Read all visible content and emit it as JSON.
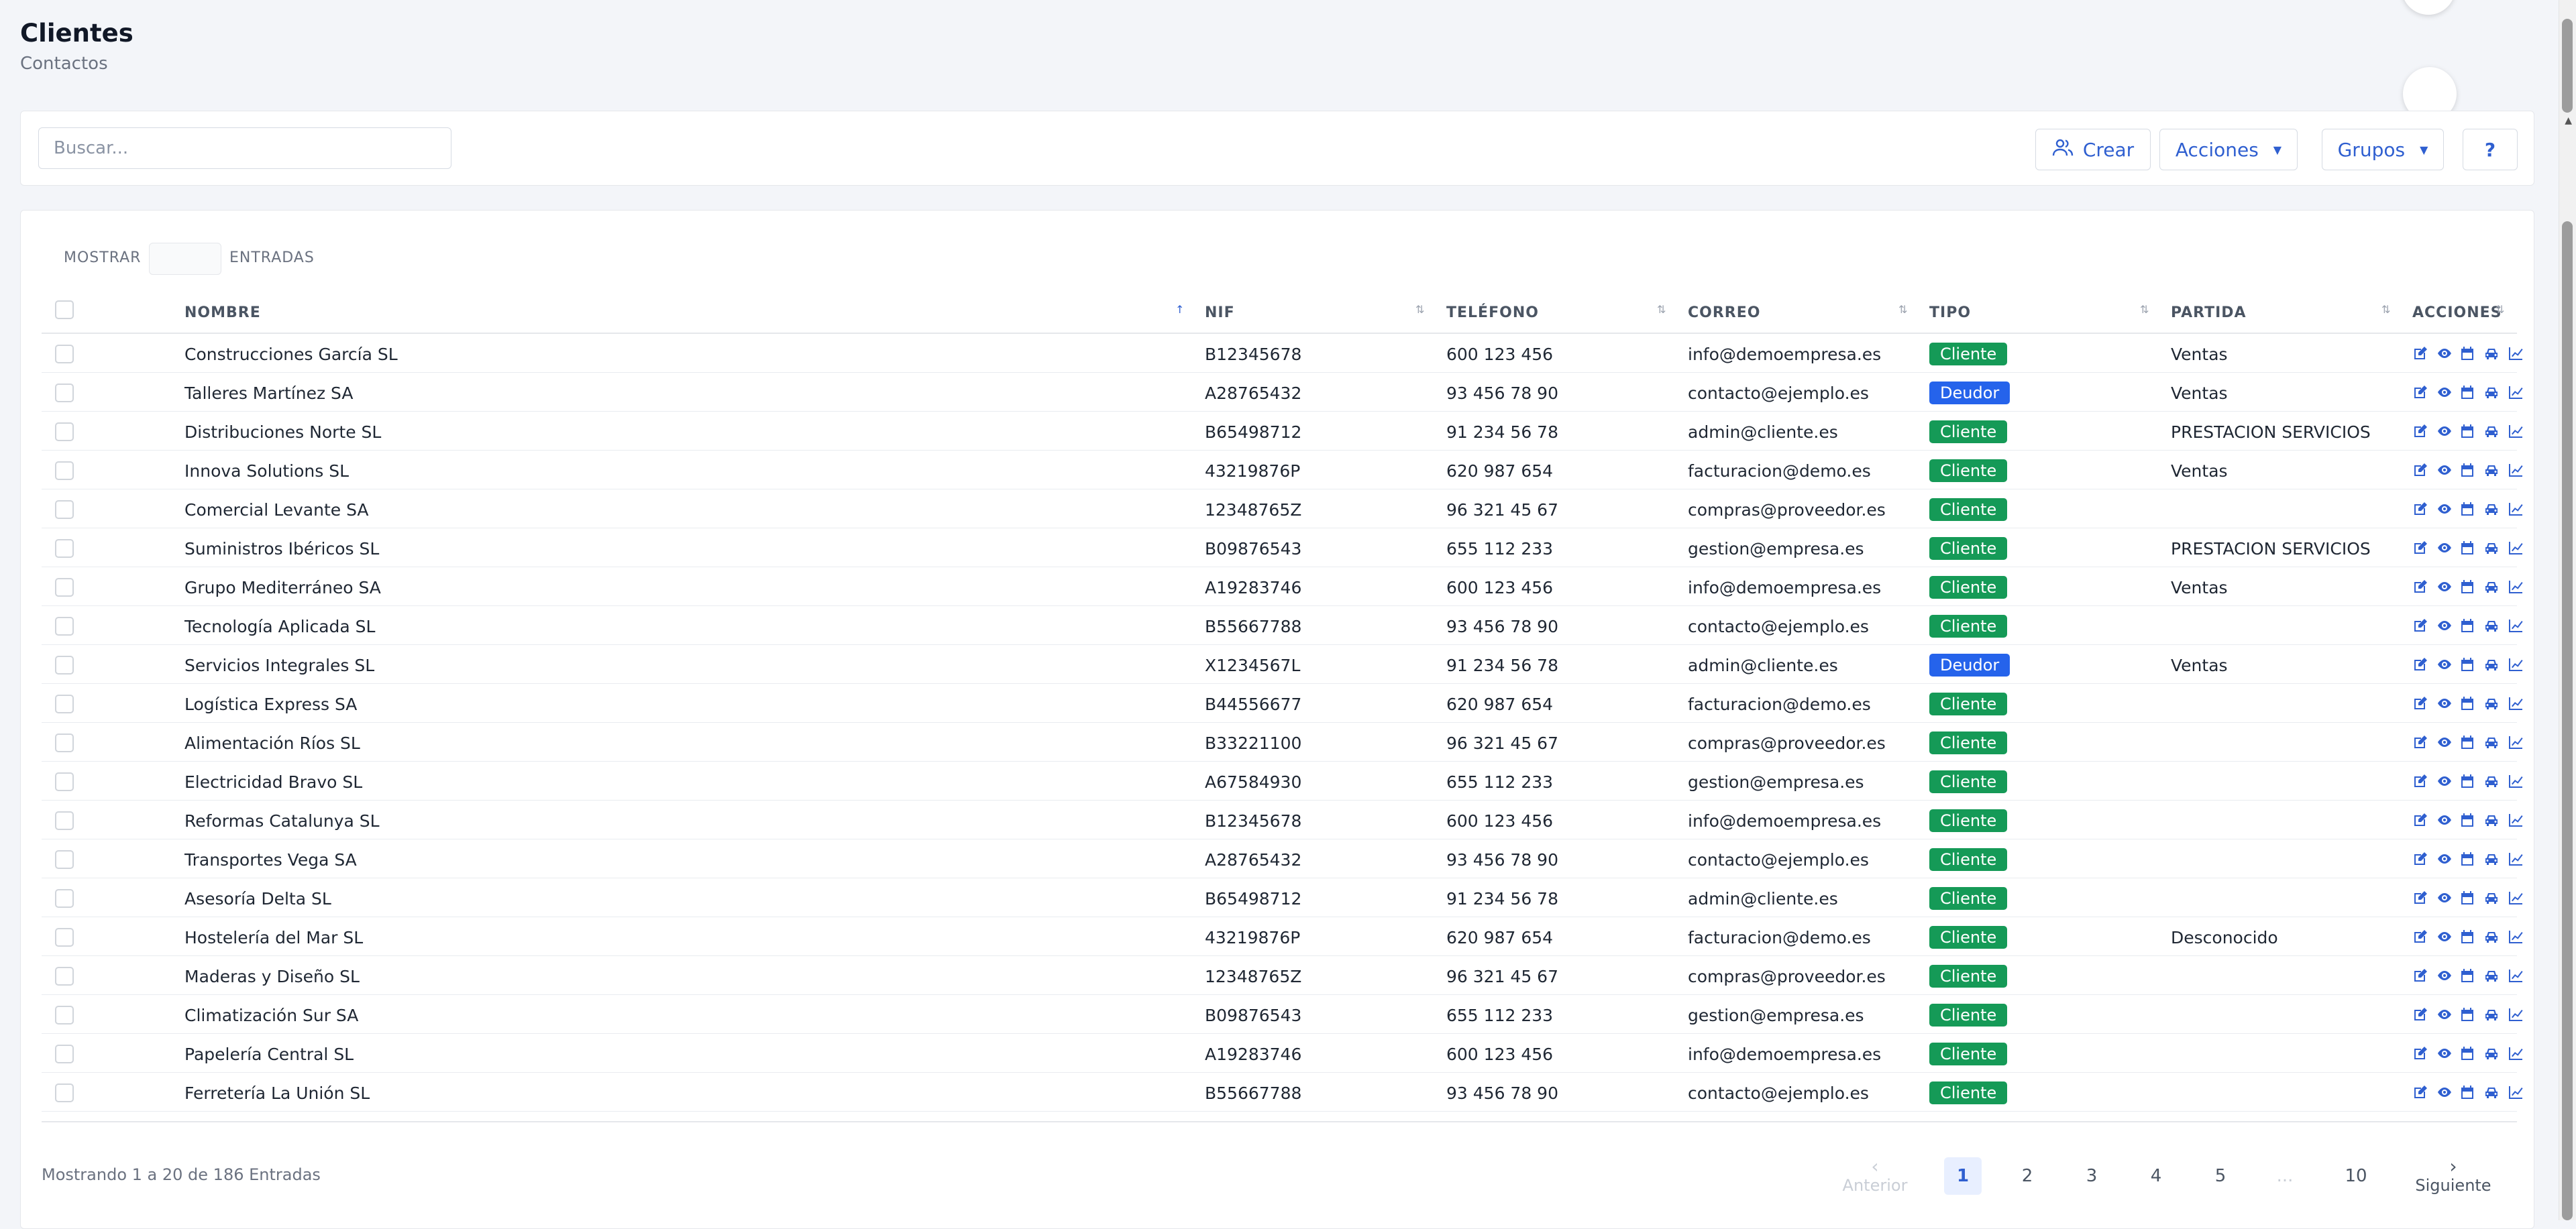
{
  "header": {
    "title": "Clientes",
    "subtitle": "Contactos"
  },
  "toolbar": {
    "search_placeholder": "Buscar...",
    "create_label": "Crear",
    "actions_label": "Acciones",
    "groups_label": "Grupos",
    "help_label": "?"
  },
  "length_menu": {
    "show_label": "MOSTRAR",
    "entries_label": "ENTRADAS"
  },
  "table": {
    "columns": [
      "NOMBRE",
      "NIF",
      "TELÉFONO",
      "CORREO",
      "TIPO",
      "PARTIDA",
      "ACCIONES"
    ],
    "rows": [
      {
        "nombre": "Construcciones García SL",
        "nif": "B12345678",
        "telefono": "600 123 456",
        "correo": "info@demoempresa.es",
        "tipo": "Cliente",
        "partida": "Ventas"
      },
      {
        "nombre": "Talleres Martínez SA",
        "nif": "A28765432",
        "telefono": "93 456 78 90",
        "correo": "contacto@ejemplo.es",
        "tipo": "Deudor",
        "partida": "Ventas"
      },
      {
        "nombre": "Distribuciones Norte SL",
        "nif": "B65498712",
        "telefono": "91 234 56 78",
        "correo": "admin@cliente.es",
        "tipo": "Cliente",
        "partida": "PRESTACION SERVICIOS"
      },
      {
        "nombre": "Innova Solutions SL",
        "nif": "43219876P",
        "telefono": "620 987 654",
        "correo": "facturacion@demo.es",
        "tipo": "Cliente",
        "partida": "Ventas"
      },
      {
        "nombre": "Comercial Levante SA",
        "nif": "12348765Z",
        "telefono": "96 321 45 67",
        "correo": "compras@proveedor.es",
        "tipo": "Cliente",
        "partida": ""
      },
      {
        "nombre": "Suministros Ibéricos SL",
        "nif": "B09876543",
        "telefono": "655 112 233",
        "correo": "gestion@empresa.es",
        "tipo": "Cliente",
        "partida": "PRESTACION SERVICIOS"
      },
      {
        "nombre": "Grupo Mediterráneo SA",
        "nif": "A19283746",
        "telefono": "600 123 456",
        "correo": "info@demoempresa.es",
        "tipo": "Cliente",
        "partida": "Ventas"
      },
      {
        "nombre": "Tecnología Aplicada SL",
        "nif": "B55667788",
        "telefono": "93 456 78 90",
        "correo": "contacto@ejemplo.es",
        "tipo": "Cliente",
        "partida": ""
      },
      {
        "nombre": "Servicios Integrales SL",
        "nif": "X1234567L",
        "telefono": "91 234 56 78",
        "correo": "admin@cliente.es",
        "tipo": "Deudor",
        "partida": "Ventas"
      },
      {
        "nombre": "Logística Express SA",
        "nif": "B44556677",
        "telefono": "620 987 654",
        "correo": "facturacion@demo.es",
        "tipo": "Cliente",
        "partida": ""
      },
      {
        "nombre": "Alimentación Ríos SL",
        "nif": "B33221100",
        "telefono": "96 321 45 67",
        "correo": "compras@proveedor.es",
        "tipo": "Cliente",
        "partida": ""
      },
      {
        "nombre": "Electricidad Bravo SL",
        "nif": "A67584930",
        "telefono": "655 112 233",
        "correo": "gestion@empresa.es",
        "tipo": "Cliente",
        "partida": ""
      },
      {
        "nombre": "Reformas Catalunya SL",
        "nif": "B12345678",
        "telefono": "600 123 456",
        "correo": "info@demoempresa.es",
        "tipo": "Cliente",
        "partida": ""
      },
      {
        "nombre": "Transportes Vega SA",
        "nif": "A28765432",
        "telefono": "93 456 78 90",
        "correo": "contacto@ejemplo.es",
        "tipo": "Cliente",
        "partida": ""
      },
      {
        "nombre": "Asesoría Delta SL",
        "nif": "B65498712",
        "telefono": "91 234 56 78",
        "correo": "admin@cliente.es",
        "tipo": "Cliente",
        "partida": ""
      },
      {
        "nombre": "Hostelería del Mar SL",
        "nif": "43219876P",
        "telefono": "620 987 654",
        "correo": "facturacion@demo.es",
        "tipo": "Cliente",
        "partida": "Desconocido"
      },
      {
        "nombre": "Maderas y Diseño SL",
        "nif": "12348765Z",
        "telefono": "96 321 45 67",
        "correo": "compras@proveedor.es",
        "tipo": "Cliente",
        "partida": ""
      },
      {
        "nombre": "Climatización Sur SA",
        "nif": "B09876543",
        "telefono": "655 112 233",
        "correo": "gestion@empresa.es",
        "tipo": "Cliente",
        "partida": ""
      },
      {
        "nombre": "Papelería Central SL",
        "nif": "A19283746",
        "telefono": "600 123 456",
        "correo": "info@demoempresa.es",
        "tipo": "Cliente",
        "partida": ""
      },
      {
        "nombre": "Ferretería La Unión SL",
        "nif": "B55667788",
        "telefono": "93 456 78 90",
        "correo": "contacto@ejemplo.es",
        "tipo": "Cliente",
        "partida": ""
      }
    ],
    "row_action_icons": [
      "edit-icon",
      "view-icon",
      "calendar-icon",
      "car-icon",
      "chart-icon"
    ]
  },
  "footer": {
    "info": "Mostrando 1 a 20 de 186 Entradas",
    "prev_label": "Anterior",
    "next_label": "Siguiente",
    "pages": [
      "1",
      "2",
      "3",
      "4",
      "5",
      "...",
      "10"
    ],
    "current_page": "1"
  },
  "colors": {
    "accent": "#2f5fd0",
    "cliente_badge": "#159a57",
    "deudor_badge": "#2563eb"
  }
}
